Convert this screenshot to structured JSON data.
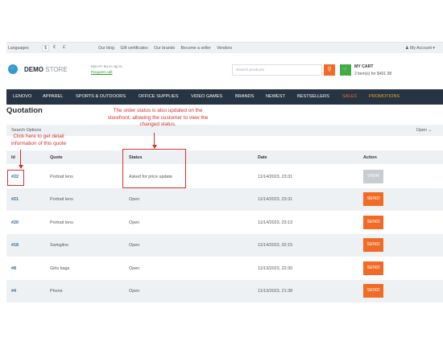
{
  "topbar": {
    "languages_label": "Languages",
    "currencies": [
      "$",
      "€",
      "£"
    ],
    "links": [
      "Our blog",
      "Gift certificates",
      "Our brands",
      "Become a seller",
      "Vendors"
    ],
    "account_label": "My Account"
  },
  "header": {
    "logo_bold": "DEMO",
    "logo_light": "STORE",
    "hours": "Mon-Fr 9a.m.-6p.m.",
    "request_call": "Request call",
    "search_placeholder": "Search products",
    "cart_title": "MY CART",
    "cart_sub": "2 item(s) for $401.98"
  },
  "nav": {
    "items": [
      "LENOVO",
      "APPAREL",
      "SPORTS & OUTDOORS",
      "OFFICE SUPPLIES",
      "VIDEO GAMES",
      "BRANDS",
      "NEWEST",
      "BESTSELLERS",
      "SALES",
      "PROMOTIONS"
    ]
  },
  "page": {
    "title": "Quotation",
    "search_options": "Search Options",
    "open_label": "Open"
  },
  "annotations": {
    "status_note": "The order status is also updated on the storefront, allowing the customer to view the changed status.",
    "detail_note": "Click here to get detail information of this quote"
  },
  "table": {
    "headers": [
      "Id",
      "Quote",
      "Status",
      "Date",
      "Action"
    ],
    "rows": [
      {
        "id": "#22",
        "quote": "Portrait lens",
        "status": "Asked for price update",
        "date": "11/14/2023, 23:31",
        "action": "VIEW"
      },
      {
        "id": "#21",
        "quote": "Portrait lens",
        "status": "Open",
        "date": "11/14/2023, 23:31",
        "action": "SEND"
      },
      {
        "id": "#20",
        "quote": "Portrait lens",
        "status": "Open",
        "date": "11/14/2023, 23:13",
        "action": "SEND"
      },
      {
        "id": "#18",
        "quote": "Swingline",
        "status": "Open",
        "date": "11/14/2023, 02:15",
        "action": "SEND"
      },
      {
        "id": "#8",
        "quote": "Girls bags",
        "status": "Open",
        "date": "11/13/2023, 22:30",
        "action": "SEND"
      },
      {
        "id": "#4",
        "quote": "Phone",
        "status": "Open",
        "date": "11/13/2023, 21:38",
        "action": "SEND"
      }
    ]
  },
  "colors": {
    "accent_orange": "#f26b26",
    "nav_bg": "#273444",
    "annotation_red": "#d0312d",
    "cart_green": "#3fae3f"
  }
}
